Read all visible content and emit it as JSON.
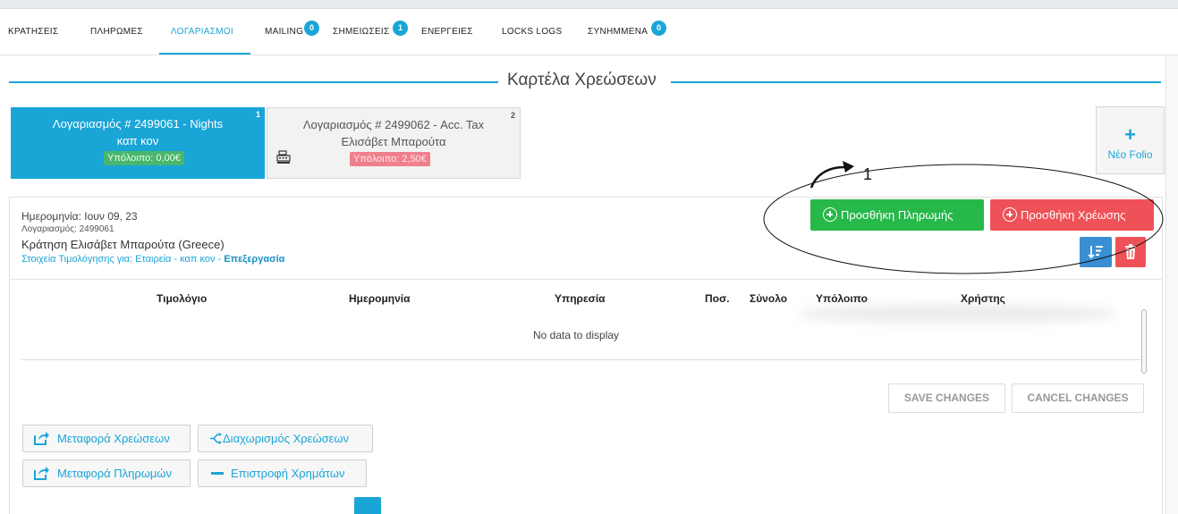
{
  "tabs": [
    {
      "label": "ΚΡΑΤΗΣΕΙΣ"
    },
    {
      "label": "ΠΛΗΡΩΜΕΣ"
    },
    {
      "label": "ΛΟΓΑΡΙΑΣΜΟΙ"
    },
    {
      "label": "MAILING",
      "badge": "0"
    },
    {
      "label": "ΣΗΜΕΙΩΣΕΙΣ",
      "badge": "1"
    },
    {
      "label": "ΕΝΕΡΓΕΙΕΣ"
    },
    {
      "label": "LOCKS LOGS"
    },
    {
      "label": "ΣΥΝΗΜΜΕΝΑ",
      "badge": "0"
    }
  ],
  "active_tab": "ΛΟΓΑΡΙΑΣΜΟΙ",
  "section_title": "Καρτέλα Χρεώσεων",
  "folios": [
    {
      "number": "1",
      "line1": "Λογαριασμός # 2499061 - Nights",
      "line2": "καπ κον",
      "balance": "Υπόλοιπο: 0,00€"
    },
    {
      "number": "2",
      "line1": "Λογαριασμός # 2499062 - Acc. Tax",
      "line2": "Ελισάβετ Μπαρούτα",
      "balance": "Υπόλοιπο: 2,50€"
    }
  ],
  "new_folio": {
    "plus": "+",
    "label": "Νέο Folio"
  },
  "info": {
    "date": "Ημερομηνία: Ιουν 09, 23",
    "account": "Λογαριασμός: 2499061",
    "reservation": "Κράτηση Ελισάβετ Μπαρούτα (Greece)",
    "billing": "Στοιχεία Τιμολόγησης για: Εταιρεία - καπ κον - ",
    "edit_link": "Επεξεργασία"
  },
  "actions": {
    "add_payment": "Προσθήκη Πληρωμής",
    "add_charge": "Προσθήκη Χρέωσης"
  },
  "grid": {
    "columns": [
      "Τιμολόγιο",
      "Ημερομηνία",
      "Υπηρεσία",
      "Ποσ.",
      "Σύνολο",
      "Υπόλοιπο",
      "Χρήστης"
    ],
    "empty_text": "No data to display"
  },
  "grid_buttons": {
    "save": "SAVE CHANGES",
    "cancel": "CANCEL CHANGES"
  },
  "bottom_actions": {
    "transfer_charges": "Μεταφορά Χρεώσεων",
    "split_charges": "Διαχωρισμός Χρεώσεων",
    "transfer_payments": "Μεταφορά Πληρωμών",
    "refund": "Επιστροφή Χρημάτων"
  },
  "annotation": {
    "number": "1"
  },
  "colors": {
    "accent": "#1aa5d7",
    "payment": "#27b84a",
    "charge": "#ef5158",
    "balance_ok": "#49b56e",
    "balance_due": "#f07f8d"
  }
}
